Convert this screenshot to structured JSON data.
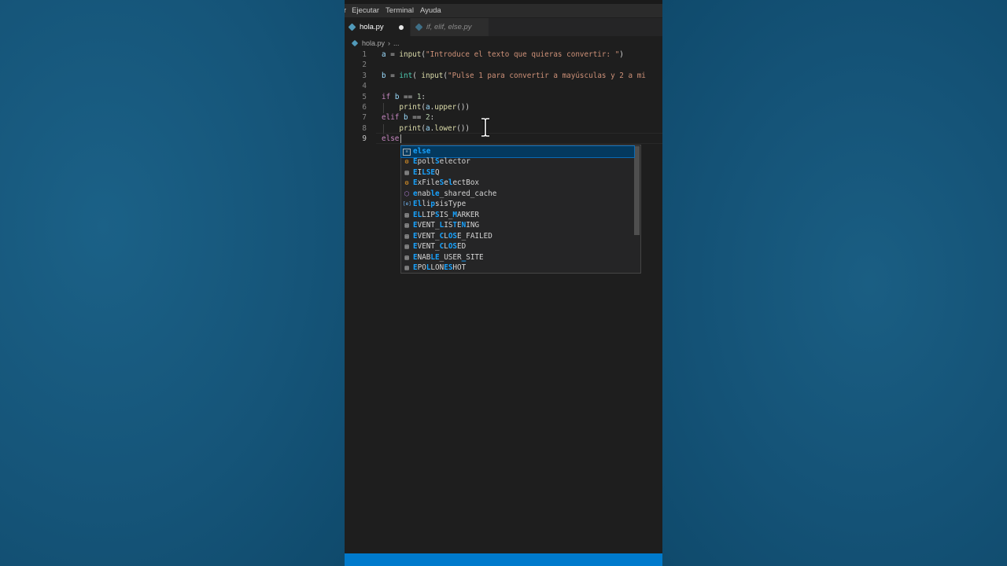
{
  "menu": {
    "items": [
      "r",
      "Ejecutar",
      "Terminal",
      "Ayuda"
    ]
  },
  "tabs": [
    {
      "label": "hola.py",
      "active": true,
      "dirty": true
    },
    {
      "label": "if, elif, else.py",
      "active": false
    }
  ],
  "breadcrumb": {
    "file": "hola.py",
    "sep": "›",
    "more": "..."
  },
  "editor": {
    "current_line": 9,
    "lines": [
      {
        "n": "1",
        "html": "<span class=\"var\">a</span> = <span class=\"fn\">input</span>(<span class=\"str\">\"Introduce el texto que quieras convertir: \"</span>)"
      },
      {
        "n": "2",
        "html": ""
      },
      {
        "n": "3",
        "html": "<span class=\"var\">b</span> = <span class=\"bi\">int</span>( <span class=\"fn\">input</span>(<span class=\"str\">\"Pulse 1 para convertir a mayúsculas y 2 a mi</span>"
      },
      {
        "n": "4",
        "html": ""
      },
      {
        "n": "5",
        "html": "<span class=\"kw\">if</span> <span class=\"var\">b</span> == <span class=\"num\">1</span>:"
      },
      {
        "n": "6",
        "html": "    <span class=\"fn\">print</span>(<span class=\"var\">a</span>.<span class=\"fn\">upper</span>())"
      },
      {
        "n": "7",
        "html": "<span class=\"kw\">elif</span> <span class=\"var\">b</span> == <span class=\"num\">2</span>:"
      },
      {
        "n": "8",
        "html": "    <span class=\"fn\">print</span>(<span class=\"var\">a</span>.<span class=\"fn\">lower</span>())"
      },
      {
        "n": "9",
        "html": "<span class=\"kw\">else</span>"
      }
    ]
  },
  "suggestions": {
    "items": [
      {
        "kind": "keyword",
        "icon": "keyword-icon",
        "glyph": "≡",
        "pre": "",
        "hl": "else",
        "post": "",
        "selected": true
      },
      {
        "kind": "class",
        "icon": "class-icon",
        "glyph": "⚙",
        "pre": "",
        "hl": "E",
        "post": "pollSelector",
        "hl_s": true,
        "label": "EpollSelector"
      },
      {
        "kind": "const",
        "icon": "constant-icon",
        "glyph": "▤",
        "label": "EILSEQ"
      },
      {
        "kind": "class",
        "icon": "class-icon",
        "glyph": "⚙",
        "label": "ExFileSelectBox"
      },
      {
        "kind": "method",
        "icon": "method-icon",
        "glyph": "⬡",
        "label": "enable_shared_cache"
      },
      {
        "kind": "var",
        "icon": "variable-icon",
        "glyph": "[e]",
        "label": "EllipsisType"
      },
      {
        "kind": "const",
        "icon": "constant-icon",
        "glyph": "▤",
        "label": "ELLIPSIS_MARKER"
      },
      {
        "kind": "const",
        "icon": "constant-icon",
        "glyph": "▤",
        "label": "EVENT_LISTENING"
      },
      {
        "kind": "const",
        "icon": "constant-icon",
        "glyph": "▤",
        "label": "EVENT_CLOSE_FAILED"
      },
      {
        "kind": "const",
        "icon": "constant-icon",
        "glyph": "▤",
        "label": "EVENT_CLOSED"
      },
      {
        "kind": "const",
        "icon": "constant-icon",
        "glyph": "▤",
        "label": "ENABLE_USER_SITE"
      },
      {
        "kind": "const",
        "icon": "constant-icon",
        "glyph": "▤",
        "label": "EPOLLONESHOT"
      }
    ],
    "highlights": {
      "EpollSelector": [
        [
          0,
          1
        ],
        [
          5,
          6
        ]
      ],
      "EILSEQ": [
        [
          0,
          1
        ],
        [
          2,
          5
        ]
      ],
      "ExFileSelectBox": [
        [
          0,
          1
        ],
        [
          6,
          7
        ],
        [
          8,
          9
        ]
      ],
      "enable_shared_cache": [
        [
          0,
          1
        ],
        [
          4,
          6
        ]
      ],
      "EllipsisType": [
        [
          0,
          1
        ],
        [
          1,
          2
        ],
        [
          4,
          5
        ]
      ],
      "ELLIPSIS_MARKER": [
        [
          0,
          1
        ],
        [
          1,
          2
        ],
        [
          5,
          6
        ],
        [
          9,
          10
        ]
      ],
      "EVENT_LISTENING": [
        [
          0,
          1
        ],
        [
          6,
          7
        ],
        [
          9,
          10
        ],
        [
          11,
          12
        ]
      ],
      "EVENT_CLOSE_FAILED": [
        [
          0,
          1
        ],
        [
          6,
          7
        ],
        [
          8,
          10
        ]
      ],
      "EVENT_CLOSED": [
        [
          0,
          1
        ],
        [
          6,
          7
        ],
        [
          8,
          10
        ]
      ],
      "ENABLE_USER_SITE": [
        [
          0,
          1
        ],
        [
          4,
          6
        ],
        [
          11,
          12
        ]
      ],
      "EPOLLONESHOT": [
        [
          0,
          1
        ],
        [
          3,
          4
        ],
        [
          7,
          9
        ]
      ]
    }
  },
  "colors": {
    "editor_bg": "#1e1e1e",
    "status_bar": "#007acc",
    "suggest_selected": "#04395e",
    "match_highlight": "#18a3ff"
  }
}
